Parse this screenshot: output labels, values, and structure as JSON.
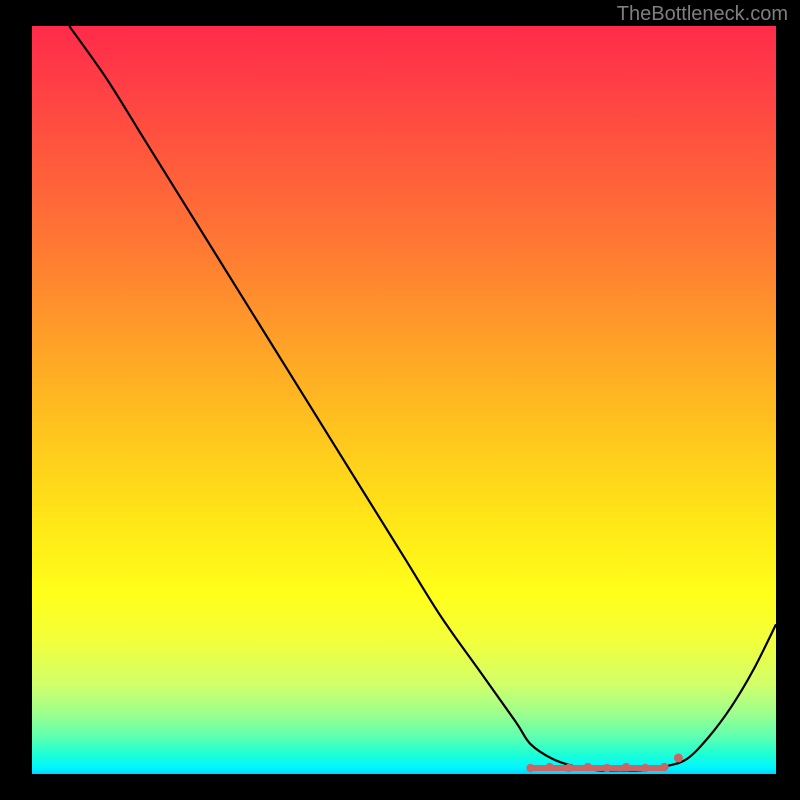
{
  "watermark": "TheBottleneck.com",
  "chart_data": {
    "type": "line",
    "title": "",
    "xlabel": "",
    "ylabel": "",
    "xlim": [
      0,
      100
    ],
    "ylim": [
      0,
      100
    ],
    "x": [
      5,
      10,
      15,
      20,
      25,
      30,
      35,
      40,
      45,
      50,
      55,
      60,
      65,
      67,
      70,
      73,
      76,
      79,
      82,
      85,
      88,
      91,
      94,
      97,
      100
    ],
    "values": [
      100,
      93,
      85,
      77,
      69,
      61,
      53,
      45,
      37,
      29,
      21,
      14,
      7,
      4,
      2,
      1,
      0.5,
      0.5,
      0.5,
      1,
      2,
      5,
      9,
      14,
      20
    ],
    "flat_region": {
      "x_start": 67,
      "x_end": 85,
      "y": 0.8
    },
    "annotations": []
  }
}
